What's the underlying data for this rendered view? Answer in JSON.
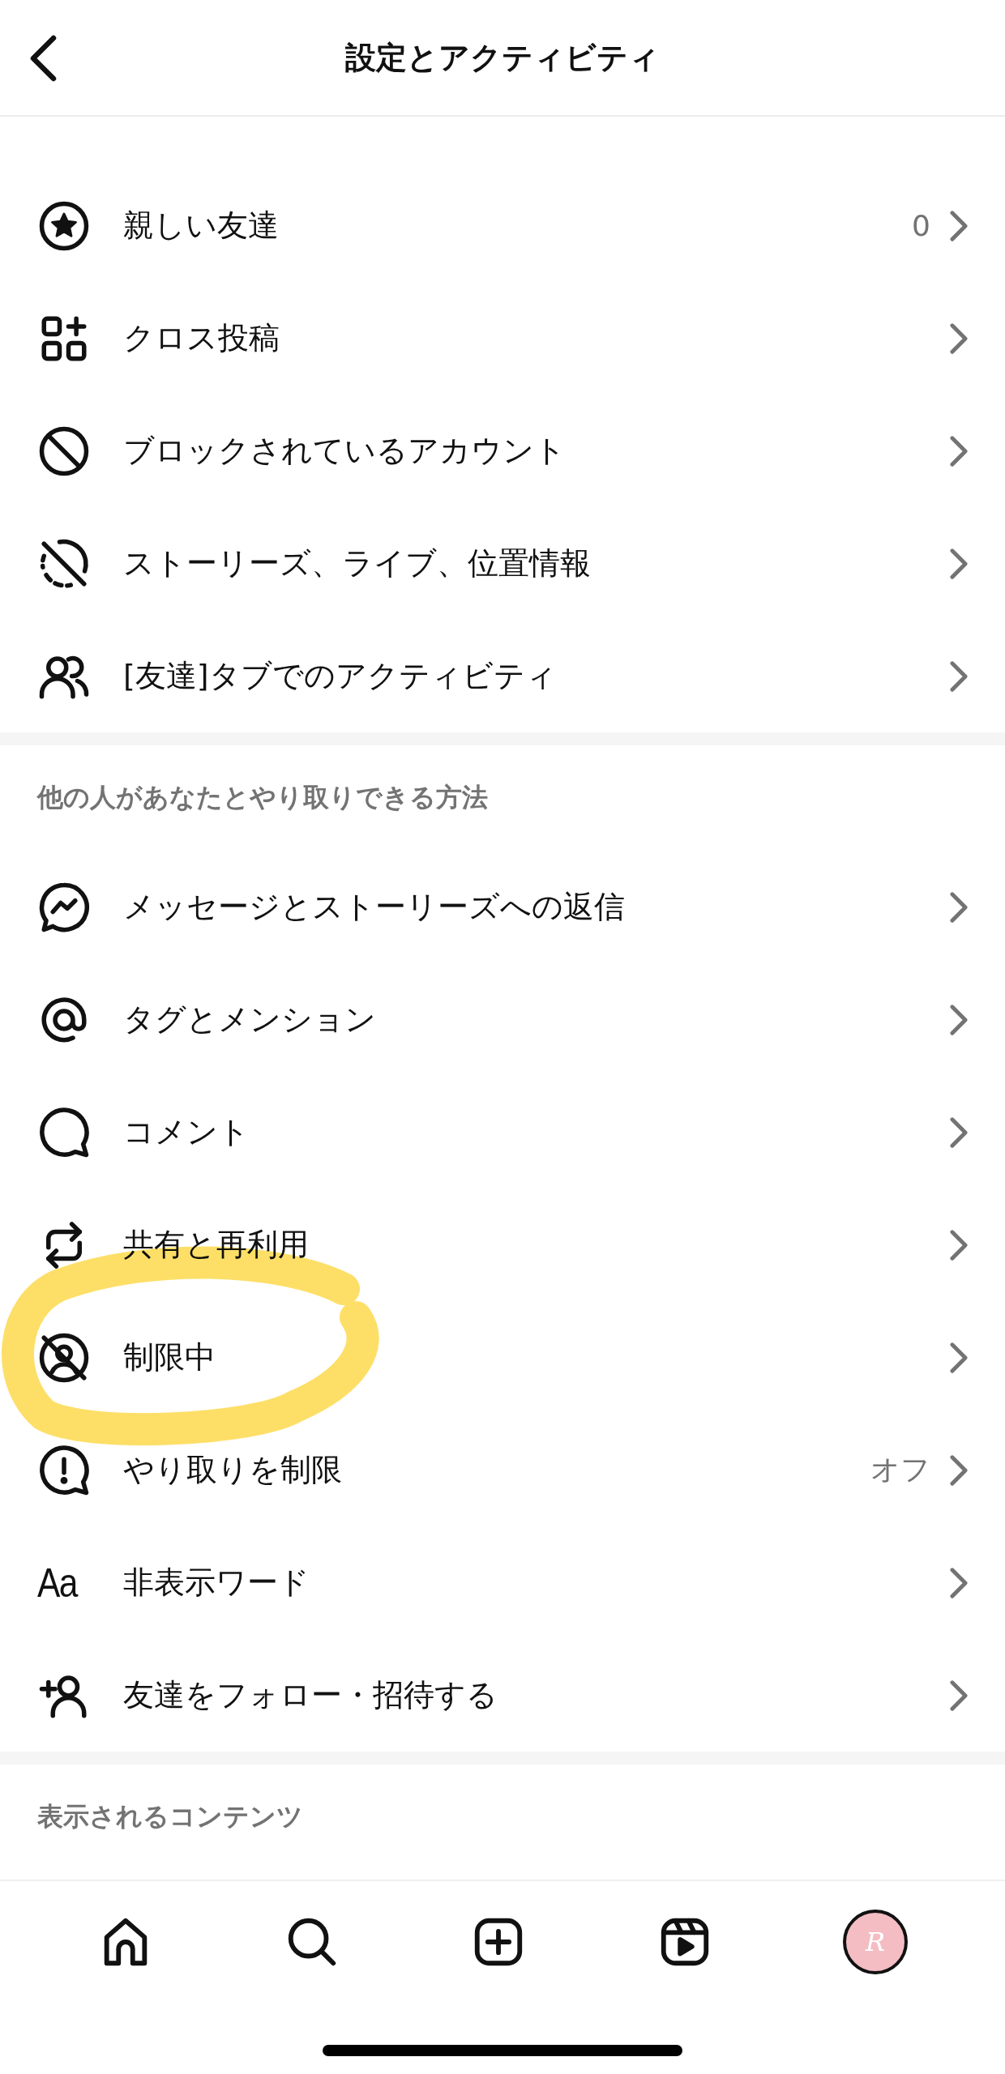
{
  "header": {
    "title": "設定とアクティビティ"
  },
  "sections": [
    {
      "items": [
        {
          "label": "親しい友達",
          "value": "0",
          "highlighted": false
        },
        {
          "label": "クロス投稿",
          "highlighted": false
        },
        {
          "label": "ブロックされているアカウント",
          "highlighted": false
        },
        {
          "label": "ストーリーズ、ライブ、位置情報",
          "highlighted": false
        },
        {
          "label": "[友達]タブでのアクティビティ",
          "highlighted": false
        }
      ]
    },
    {
      "title": "他の人があなたとやり取りできる方法",
      "items": [
        {
          "label": "メッセージとストーリーズへの返信",
          "highlighted": false
        },
        {
          "label": "タグとメンション",
          "highlighted": false
        },
        {
          "label": "コメント",
          "highlighted": false
        },
        {
          "label": "共有と再利用",
          "highlighted": false
        },
        {
          "label": "制限中",
          "highlighted": true
        },
        {
          "label": "やり取りを制限",
          "value": "オフ",
          "highlighted": false
        },
        {
          "label": "非表示ワード",
          "icon_text": "Aa",
          "highlighted": false
        },
        {
          "label": "友達をフォロー・招待する",
          "highlighted": false
        }
      ]
    },
    {
      "title": "表示されるコンテンツ"
    }
  ],
  "nav": {
    "avatar_text": "R"
  }
}
